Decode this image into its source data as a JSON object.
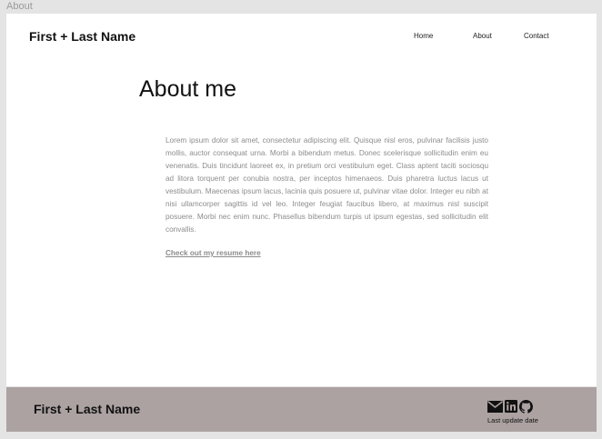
{
  "frame": {
    "label": "About"
  },
  "header": {
    "site_name": "First + Last Name",
    "nav": {
      "home": "Home",
      "about": "About",
      "contact": "Contact"
    }
  },
  "main": {
    "title": "About me",
    "body": "Lorem ipsum dolor sit amet, consectetur adipiscing elit. Quisque nisl eros, pulvinar facilisis justo mollis, auctor consequat urna. Morbi a bibendum metus. Donec scelerisque sollicitudin enim eu venenatis. Duis tincidunt laoreet ex, in pretium orci vestibulum eget. Class aptent taciti sociosqu ad litora torquent per conubia nostra, per inceptos himenaeos. Duis pharetra luctus lacus ut vestibulum. Maecenas ipsum lacus, lacinia quis posuere ut, pulvinar vitae dolor. Integer eu nibh at nisi ullamcorper sagittis id vel leo. Integer feugiat faucibus libero, at maximus nisl suscipit posuere. Morbi nec enim nunc. Phasellus bibendum turpis ut ipsum egestas, sed sollicitudin elit convallis.",
    "resume_link": "Check out my resume here"
  },
  "footer": {
    "site_name": "First + Last Name",
    "icons": [
      "mail-icon",
      "linkedin-icon",
      "github-icon"
    ],
    "last_update": "Last update date"
  },
  "colors": {
    "background": "#e4e4e4",
    "page": "#ffffff",
    "footer": "#aca2a2",
    "body_text": "#8c8c8c"
  }
}
